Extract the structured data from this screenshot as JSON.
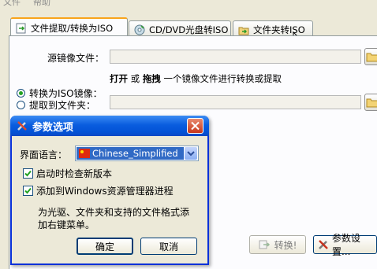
{
  "menu": {
    "file": "文件",
    "help": "帮助"
  },
  "tabs": [
    {
      "label": "文件提取/转换为ISO"
    },
    {
      "label": "CD/DVD光盘转ISO"
    },
    {
      "label": "文件夹转ISO"
    }
  ],
  "main": {
    "source_label": "源镜像文件：",
    "hint_open": "打开",
    "hint_or": "或",
    "hint_drag": "拖拽",
    "hint_rest": "一个镜像文件进行转换或提取",
    "radio_convert": "转换为ISO镜像：",
    "radio_extract": "提取到文件夹：",
    "convert_button": "转换!",
    "settings_button": "参数设置..."
  },
  "dialog": {
    "title": "参数选项",
    "language_label": "界面语言：",
    "language_value": "Chinese_Simplified",
    "check_update_label": "启动时检查新版本",
    "check_update_checked": true,
    "explorer_label": "添加到Windows资源管理器进程",
    "explorer_checked": true,
    "description_line1": "为光驱、文件夹和支持的文件格式添",
    "description_line2": "加右键菜单。",
    "ok_button": "确定",
    "cancel_button": "取消"
  },
  "colors": {
    "accent_tab": "#f8a41c",
    "title_bar": "#0a5ddf",
    "close_button": "#d8432c"
  }
}
